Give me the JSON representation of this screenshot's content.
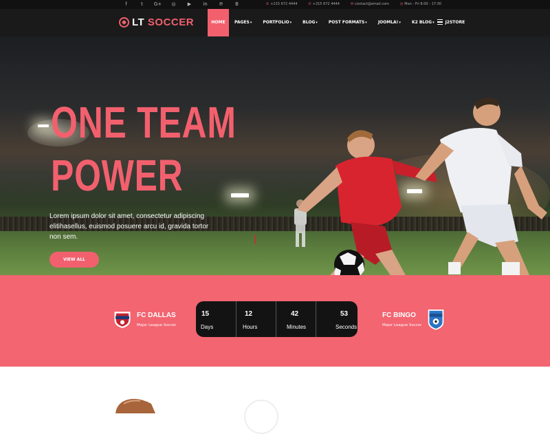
{
  "topbar": {
    "social_icons": [
      {
        "name": "facebook-icon",
        "glyph": "f"
      },
      {
        "name": "twitter-icon",
        "glyph": "t"
      },
      {
        "name": "google-plus-icon",
        "glyph": "G+"
      },
      {
        "name": "dribbble-icon",
        "glyph": "◎"
      },
      {
        "name": "youtube-icon",
        "glyph": "▶"
      },
      {
        "name": "linkedin-icon",
        "glyph": "in"
      },
      {
        "name": "pinterest-icon",
        "glyph": "℗"
      },
      {
        "name": "vk-icon",
        "glyph": "В"
      }
    ],
    "contacts": [
      {
        "icon": "phone-icon",
        "text": "+215 672 4444"
      },
      {
        "icon": "phone-icon",
        "text": "+215 672 4444"
      },
      {
        "icon": "email-icon",
        "text": "contact@email.com"
      },
      {
        "icon": "clock-icon",
        "text": "Mon - Fri 8:00 - 17:30"
      }
    ]
  },
  "navbar": {
    "logo_lt": "LT",
    "logo_soccer": "SOCCER",
    "menu": [
      {
        "label": "HOME",
        "active": true,
        "caret": ""
      },
      {
        "label": "PAGES",
        "caret": "▾"
      },
      {
        "label": "PORTFOLIO",
        "caret": "▾"
      },
      {
        "label": "BLOG",
        "caret": "▾"
      },
      {
        "label": "POST FORMATS",
        "caret": "▾"
      },
      {
        "label": "JOOMLA!",
        "caret": "▾"
      },
      {
        "label": "K2 BLOG",
        "caret": "▾"
      },
      {
        "label": "J2STORE",
        "caret": ""
      }
    ]
  },
  "hero": {
    "headline_line1": "ONE TEAM",
    "headline_line2": "POWER",
    "text": "Lorem ipsum dolor sit amet, consectetur adipiscing elitihasellus, euismod posuere arcu id, gravida tortor non sem.",
    "cta": "VIEW ALL"
  },
  "match": {
    "home": {
      "name": "FC DALLAS",
      "league": "Major League Soccer",
      "badge_text": "SOCCER"
    },
    "away": {
      "name": "FC BINGO",
      "league": "Major League Soccer",
      "badge_text": "FOOTBALL"
    },
    "countdown": [
      {
        "value": "15",
        "label": "Days"
      },
      {
        "value": "12",
        "label": "Hours"
      },
      {
        "value": "42",
        "label": "Minutes"
      },
      {
        "value": "53",
        "label": "Seconds"
      }
    ]
  },
  "colors": {
    "accent": "#f2606e",
    "dark": "#1a1a1a",
    "band": "#f26571"
  }
}
